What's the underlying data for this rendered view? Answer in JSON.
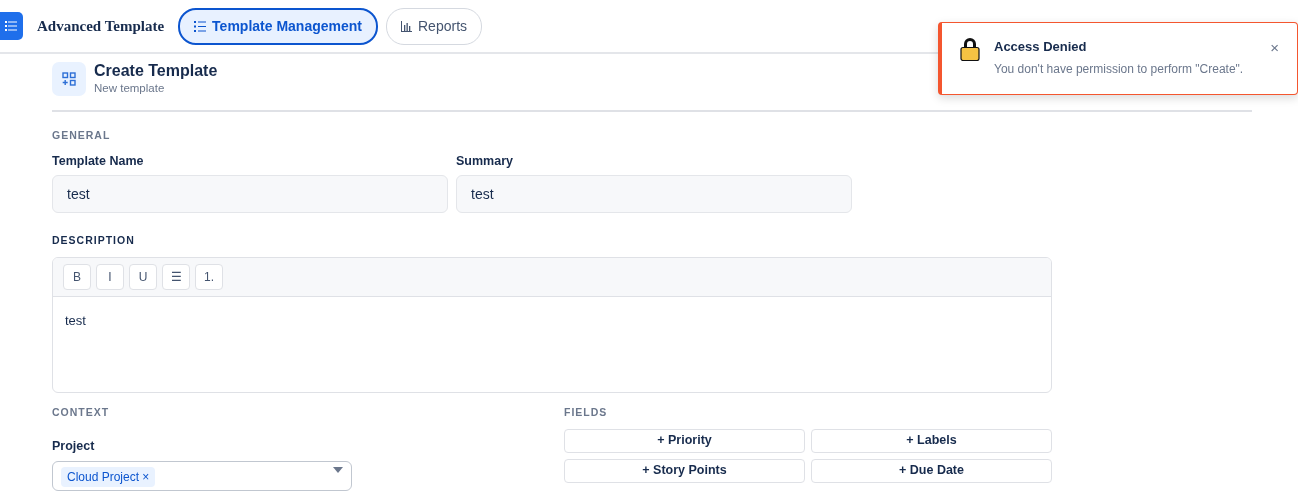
{
  "navbar": {
    "brand": "Advanced Template",
    "tabs": [
      {
        "label": "Template Management",
        "kind": "list",
        "selected": true
      },
      {
        "label": "Reports",
        "kind": "chart",
        "selected": false
      }
    ]
  },
  "header": {
    "title": "Create Template",
    "subtitle": "New template"
  },
  "general": {
    "heading": "GENERAL",
    "fields": [
      {
        "label": "Template Name",
        "value": "test"
      },
      {
        "label": "Summary",
        "value": "test"
      }
    ]
  },
  "description": {
    "heading": "DESCRIPTION",
    "toolbar": [
      "B",
      "I",
      "U",
      "☰",
      "1."
    ],
    "value": "test"
  },
  "context": {
    "heading": "CONTEXT",
    "project": {
      "label": "Project",
      "chips": [
        "Cloud Project ×"
      ]
    }
  },
  "fields": {
    "heading": "FIELDS",
    "buttons": [
      "+ Priority",
      "+ Labels",
      "+ Story Points",
      "+ Due Date"
    ]
  },
  "toast": {
    "title": "Access Denied",
    "message": "You don't have permission to perform \"Create\".",
    "close": "×"
  }
}
